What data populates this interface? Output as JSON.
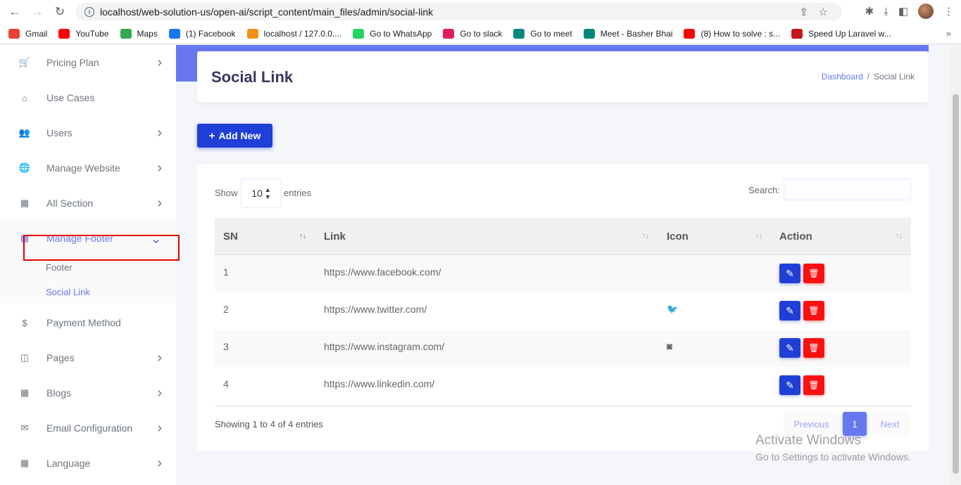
{
  "browser": {
    "url": "localhost/web-solution-us/open-ai/script_content/main_files/admin/social-link",
    "bookmarks": [
      {
        "label": "Gmail",
        "icon": "gmail-icon",
        "color": "#ea4335"
      },
      {
        "label": "YouTube",
        "icon": "youtube-icon",
        "color": "#ff0000"
      },
      {
        "label": "Maps",
        "icon": "maps-icon",
        "color": "#34a853"
      },
      {
        "label": "(1) Facebook",
        "icon": "facebook-icon",
        "color": "#1877f2"
      },
      {
        "label": "localhost / 127.0.0....",
        "icon": "phpmyadmin-icon",
        "color": "#f29111"
      },
      {
        "label": "Go to WhatsApp",
        "icon": "whatsapp-icon",
        "color": "#25d366"
      },
      {
        "label": "Go to slack",
        "icon": "slack-icon",
        "color": "#e01e5a"
      },
      {
        "label": "Go to meet",
        "icon": "meet-icon",
        "color": "#00897b"
      },
      {
        "label": "Meet - Basher Bhai",
        "icon": "meet-icon",
        "color": "#00897b"
      },
      {
        "label": "(8) How to solve : s...",
        "icon": "youtube-icon",
        "color": "#ff0000"
      },
      {
        "label": "Speed Up Laravel w...",
        "icon": "laravel-icon",
        "color": "#c4161c"
      }
    ]
  },
  "sidebar": {
    "items": [
      {
        "label": "Pricing Plan",
        "icon": "cart-icon",
        "glyph": "🛒",
        "chevron": ">"
      },
      {
        "label": "Use Cases",
        "icon": "home-icon",
        "glyph": "⌂",
        "chevron": ""
      },
      {
        "label": "Users",
        "icon": "users-icon",
        "glyph": "👥",
        "chevron": ">"
      },
      {
        "label": "Manage Website",
        "icon": "globe-icon",
        "glyph": "🌐",
        "chevron": ">"
      },
      {
        "label": "All Section",
        "icon": "grid-icon",
        "glyph": "▦",
        "chevron": ">"
      },
      {
        "label": "Manage Footer",
        "icon": "grid-icon",
        "glyph": "▦",
        "chevron": "v"
      },
      {
        "label": "Payment Method",
        "icon": "dollar-icon",
        "glyph": "$",
        "chevron": ""
      },
      {
        "label": "Pages",
        "icon": "columns-icon",
        "glyph": "◫",
        "chevron": ">"
      },
      {
        "label": "Blogs",
        "icon": "grid-icon",
        "glyph": "▦",
        "chevron": ">"
      },
      {
        "label": "Email Configuration",
        "icon": "envelope-icon",
        "glyph": "✉",
        "chevron": ">"
      },
      {
        "label": "Language",
        "icon": "grid-icon",
        "glyph": "▦",
        "chevron": ">"
      }
    ],
    "submenu": [
      {
        "label": "Footer"
      },
      {
        "label": "Social Link"
      }
    ],
    "accent": "#6777ef"
  },
  "header": {
    "title": "Social Link",
    "breadcrumb_home": "Dashboard",
    "breadcrumb_sep": "/",
    "breadcrumb_current": "Social Link"
  },
  "toolbar": {
    "add_label": "Add New",
    "add_icon": "+"
  },
  "table": {
    "show_label": "Show",
    "length_value": "10",
    "entries_label": "entries",
    "search_label": "Search:",
    "columns": [
      "SN",
      "Link",
      "Icon",
      "Action"
    ],
    "rows": [
      {
        "sn": "1",
        "link": "https://www.facebook.com/",
        "icon": ""
      },
      {
        "sn": "2",
        "link": "https://www.twitter.com/",
        "icon": "🐦"
      },
      {
        "sn": "3",
        "link": "https://www.instagram.com/",
        "icon": "◙"
      },
      {
        "sn": "4",
        "link": "https://www.linkedin.com/",
        "icon": ""
      }
    ],
    "info": "Showing 1 to 4 of 4 entries",
    "pagination": {
      "previous": "Previous",
      "page": "1",
      "next": "Next"
    }
  },
  "watermark": {
    "title": "Activate Windows",
    "subtitle": "Go to Settings to activate Windows."
  }
}
